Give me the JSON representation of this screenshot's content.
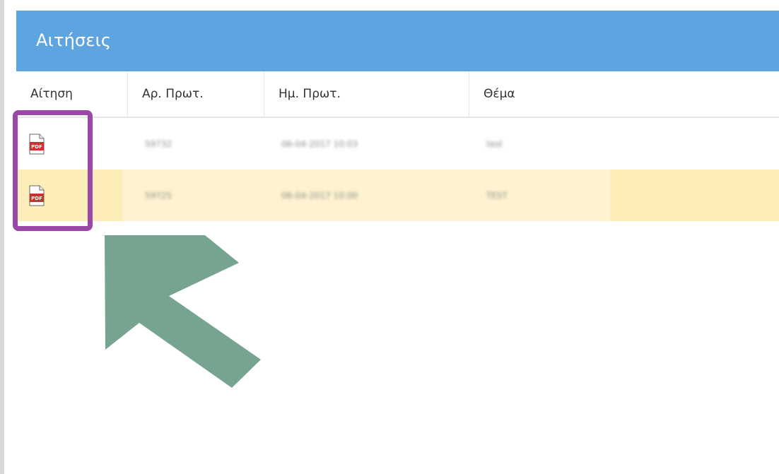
{
  "panel": {
    "title": "Αιτήσεις"
  },
  "table": {
    "columns": [
      "Αίτηση",
      "Αρ. Πρωτ.",
      "Ημ. Πρωτ.",
      "Θέμα"
    ],
    "rows": [
      {
        "protocol_no": "59732",
        "protocol_date": "06-04-2017 10:03",
        "subject": "test",
        "icon": "pdf-icon"
      },
      {
        "protocol_no": "59725",
        "protocol_date": "06-04-2017 10:00",
        "subject": "TEST",
        "icon": "pdf-icon"
      }
    ]
  },
  "colors": {
    "header": "#5ea4e0",
    "row_highlight": "#fdedb8",
    "annotation_box": "#9948a6",
    "annotation_arrow": "#6f9f8a"
  }
}
